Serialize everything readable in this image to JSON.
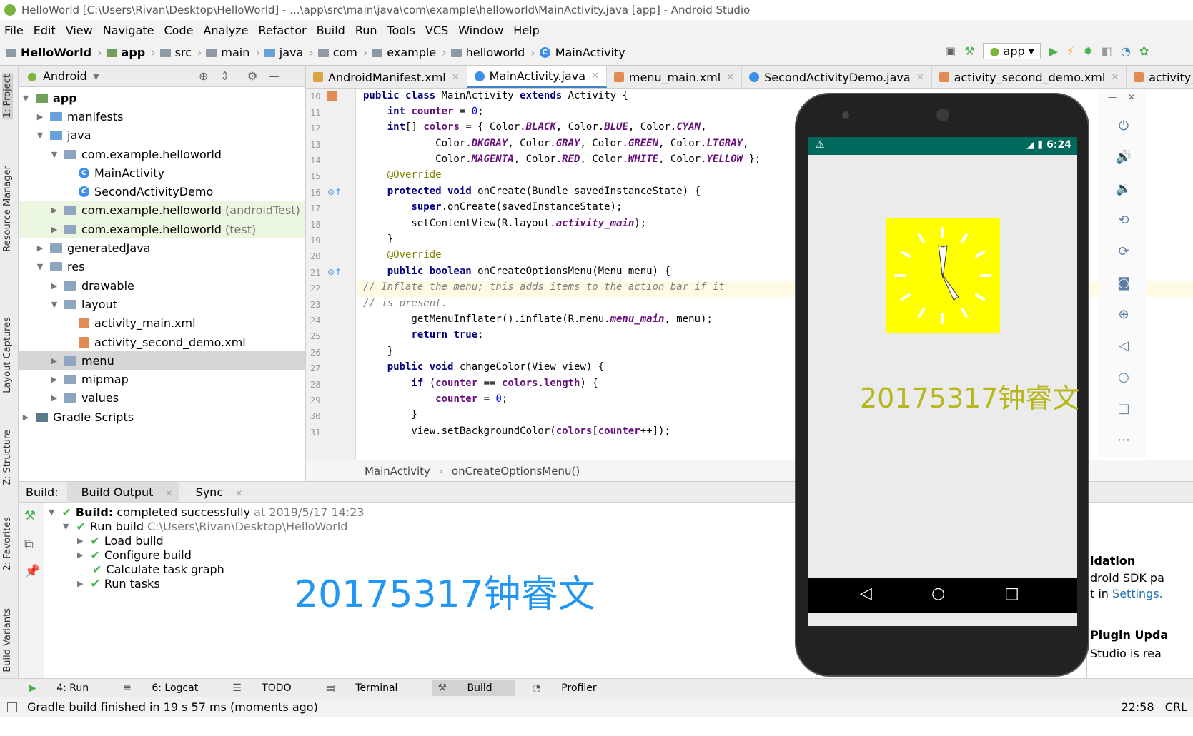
{
  "window": {
    "title": "HelloWorld [C:\\Users\\Rivan\\Desktop\\HelloWorld] - ...\\app\\src\\main\\java\\com\\example\\helloworld\\MainActivity.java [app] - Android Studio"
  },
  "menu": [
    "File",
    "Edit",
    "View",
    "Navigate",
    "Code",
    "Analyze",
    "Refactor",
    "Build",
    "Run",
    "Tools",
    "VCS",
    "Window",
    "Help"
  ],
  "breadcrumbs": [
    "HelloWorld",
    "app",
    "src",
    "main",
    "java",
    "com",
    "example",
    "helloworld",
    "MainActivity"
  ],
  "toolbar": {
    "run_config": "app"
  },
  "sidebar_left": {
    "project": "1: Project",
    "resource_manager": "Resource Manager",
    "layout_captures": "Layout Captures",
    "structure": "Z: Structure",
    "favorites": "2: Favorites",
    "build_variants": "Build Variants"
  },
  "project": {
    "view_selector": "Android",
    "tree": [
      {
        "label": "app",
        "bold": true
      },
      {
        "label": "manifests"
      },
      {
        "label": "java"
      },
      {
        "label": "com.example.helloworld"
      },
      {
        "label": "MainActivity"
      },
      {
        "label": "SecondActivityDemo"
      },
      {
        "label": "com.example.helloworld",
        "suffix": "(androidTest)"
      },
      {
        "label": "com.example.helloworld",
        "suffix": "(test)"
      },
      {
        "label": "generatedJava"
      },
      {
        "label": "res"
      },
      {
        "label": "drawable"
      },
      {
        "label": "layout"
      },
      {
        "label": "activity_main.xml"
      },
      {
        "label": "activity_second_demo.xml"
      },
      {
        "label": "menu"
      },
      {
        "label": "mipmap"
      },
      {
        "label": "values"
      },
      {
        "label": "Gradle Scripts"
      }
    ]
  },
  "tabs": [
    "AndroidManifest.xml",
    "MainActivity.java",
    "menu_main.xml",
    "SecondActivityDemo.java",
    "activity_second_demo.xml",
    "activity_main.xml"
  ],
  "editor": {
    "line_numbers": [
      "10",
      "11",
      "12",
      "13",
      "14",
      "15",
      "16",
      "17",
      "18",
      "19",
      "20",
      "21",
      "22",
      "23",
      "24",
      "25",
      "26",
      "27",
      "28",
      "29",
      "30",
      "31"
    ],
    "breadcrumb": [
      "MainActivity",
      "onCreateOptionsMenu()"
    ]
  },
  "build": {
    "label": "Build:",
    "tabs": [
      "Build Output",
      "Sync"
    ],
    "status_bold": "Build:",
    "status_text": "completed successfully",
    "status_time": "at 2019/5/17 14:23",
    "run_build": "Run build",
    "run_path": "C:\\Users\\Rivan\\Desktop\\HelloWorld",
    "steps": [
      "Load build",
      "Configure build",
      "Calculate task graph",
      "Run tasks"
    ]
  },
  "watermark": "20175317钟睿文",
  "emulator": {
    "time": "6:24",
    "app_text": "20175317钟睿文"
  },
  "notifications": {
    "n1_title": "idation",
    "n1_line1": "droid SDK pa",
    "n1_line2_prefix": "t in",
    "n1_link": "Settings.",
    "n2_title": "Plugin Upda",
    "n2_line": "Studio is rea"
  },
  "bottom_tools": [
    "4: Run",
    "6: Logcat",
    "TODO",
    "Terminal",
    "Build",
    "Profiler"
  ],
  "status": {
    "message": "Gradle build finished in 19 s 57 ms (moments ago)",
    "time": "22:58",
    "encoding": "CRL"
  }
}
